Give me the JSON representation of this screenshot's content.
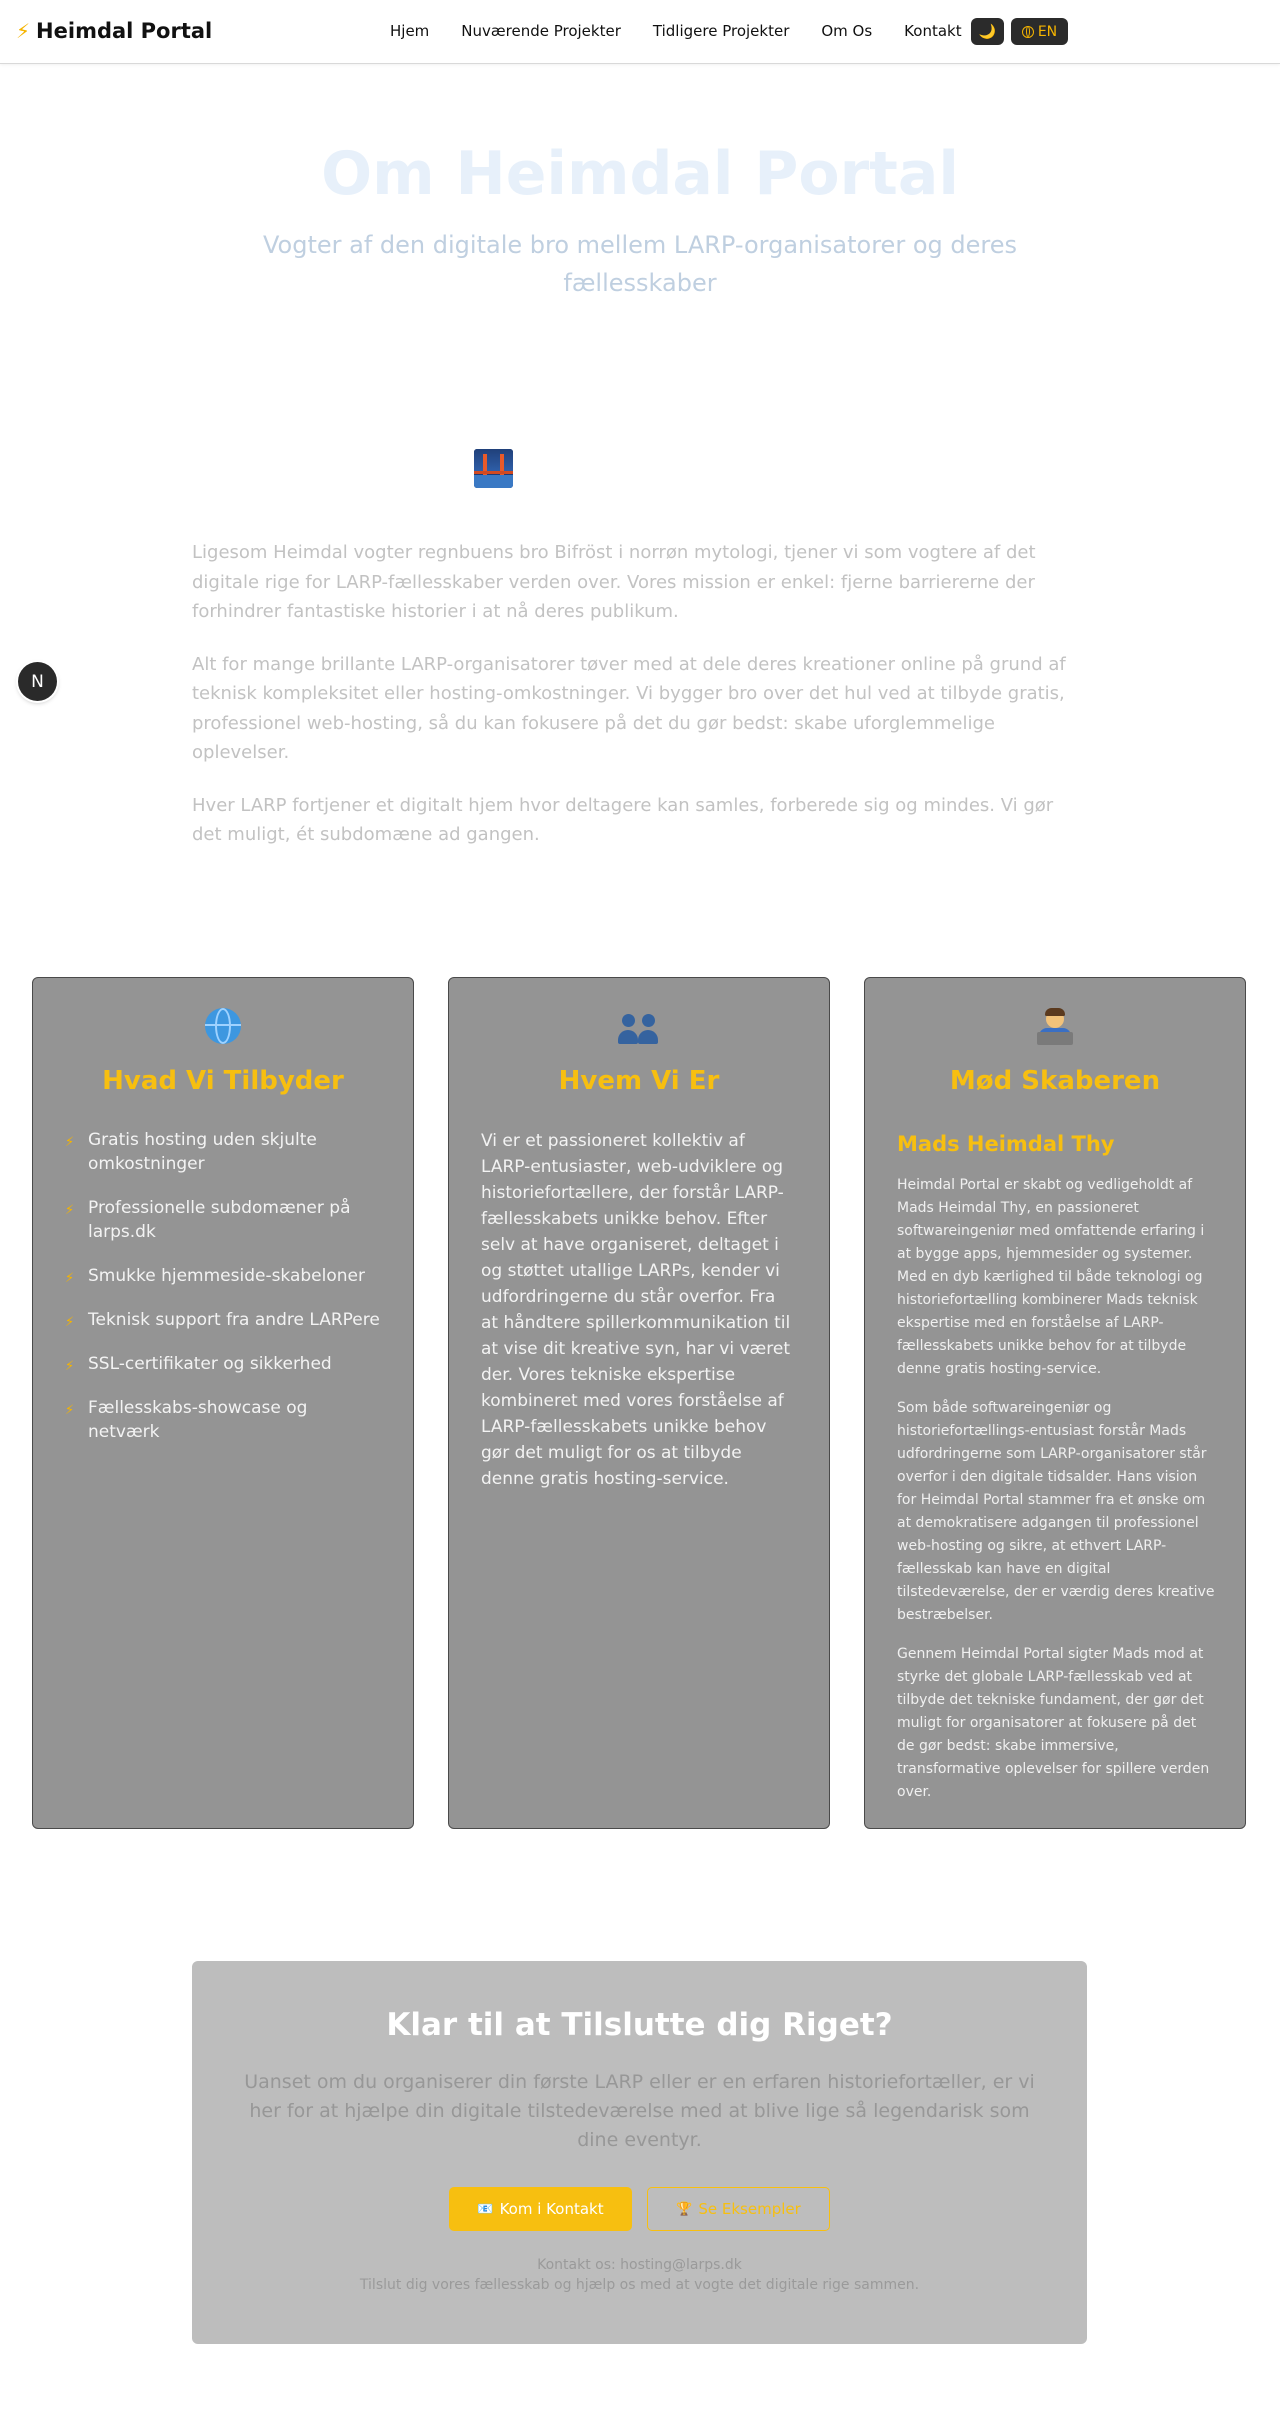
{
  "nav": {
    "brand_icon": "⚡",
    "brand_name": "Heimdal Portal",
    "links": [
      "Hjem",
      "Nuværende Projekter",
      "Tidligere Projekter",
      "Om Os",
      "Kontakt"
    ],
    "theme_icon": "moon-icon",
    "theme_glyph": "🌙",
    "lang_label": "EN"
  },
  "hero": {
    "title": "Om Heimdal Portal",
    "subtitle": "Vogter af den digitale bro mellem LARP-organisatorer og deres fællesskaber"
  },
  "story": {
    "icon": "bridge-icon",
    "paragraphs": [
      "Ligesom Heimdal vogter regnbuens bro Bifröst i norrøn mytologi, tjener vi som vogtere af det digitale rige for LARP-fællesskaber verden over. Vores mission er enkel: fjerne barriererne der forhindrer fantastiske historier i at nå deres publikum.",
      "Alt for mange brillante LARP-organisatorer tøver med at dele deres kreationer online på grund af teknisk kompleksitet eller hosting-omkostninger. Vi bygger bro over det hul ved at tilbyde gratis, professionel web-hosting, så du kan fokusere på det du gør bedst: skabe uforglemmelige oplevelser.",
      "Hver LARP fortjener et digitalt hjem hvor deltagere kan samles, forberede sig og mindes. Vi gør det muligt, ét subdomæne ad gangen."
    ]
  },
  "badge": {
    "letter": "N"
  },
  "cards": {
    "offer": {
      "icon": "globe-icon",
      "title": "Hvad Vi Tilbyder",
      "bullet_glyph": "⚡",
      "items": [
        "Gratis hosting uden skjulte omkostninger",
        "Professionelle subdomæner på larps.dk",
        "Smukke hjemmeside-skabeloner",
        "Teknisk support fra andre LARPere",
        "SSL-certifikater og sikkerhed",
        "Fællesskabs-showcase og netværk"
      ]
    },
    "who": {
      "icon": "people-icon",
      "title": "Hvem Vi Er",
      "text": "Vi er et passioneret kollektiv af LARP-entusiaster, web-udviklere og historiefortællere, der forstår LARP-fællesskabets unikke behov. Efter selv at have organiseret, deltaget i og støttet utallige LARPs, kender vi udfordringerne du står overfor. Fra at håndtere spillerkommunikation til at vise dit kreative syn, har vi været der. Vores tekniske ekspertise kombineret med vores forståelse af LARP-fællesskabets unikke behov gør det muligt for os at tilbyde denne gratis hosting-service."
    },
    "creator": {
      "icon": "technologist-icon",
      "title": "Mød Skaberen",
      "name": "Mads Heimdal Thy",
      "paragraphs": [
        "Heimdal Portal er skabt og vedligeholdt af Mads Heimdal Thy, en passioneret softwareingeniør med omfattende erfaring i at bygge apps, hjemmesider og systemer. Med en dyb kærlighed til både teknologi og historiefortælling kombinerer Mads teknisk ekspertise med en forståelse af LARP-fællesskabets unikke behov for at tilbyde denne gratis hosting-service.",
        "Som både softwareingeniør og historiefortællings-entusiast forstår Mads udfordringerne som LARP-organisatorer står overfor i den digitale tidsalder. Hans vision for Heimdal Portal stammer fra et ønske om at demokratisere adgangen til professionel web-hosting og sikre, at ethvert LARP-fællesskab kan have en digital tilstedeværelse, der er værdig deres kreative bestræbelser.",
        "Gennem Heimdal Portal sigter Mads mod at styrke det globale LARP-fællesskab ved at tilbyde det tekniske fundament, der gør det muligt for organisatorer at fokusere på det de gør bedst: skabe immersive, transformative oplevelser for spillere verden over."
      ]
    }
  },
  "cta": {
    "title": "Klar til at Tilslutte dig Riget?",
    "text": "Uanset om du organiserer din første LARP eller er en erfaren historiefortæller, er vi her for at hjælpe din digitale tilstedeværelse med at blive lige så legendarisk som dine eventyr.",
    "contact_button": {
      "icon": "envelope-icon",
      "glyph": "📧",
      "label": "Kom i Kontakt"
    },
    "examples_button": {
      "icon": "trophy-icon",
      "glyph": "🏆",
      "label": "Se Eksempler"
    },
    "contact_line": "Kontakt os: hosting@larps.dk",
    "join_line": "Tilslut dig vores fællesskab og hjælp os med at vogte det digitale rige sammen."
  },
  "colors": {
    "accent": "#f7bf10",
    "card_bg": "#949494",
    "cta_bg": "#bdbdbd",
    "nav_button_bg": "#2b2b2b"
  }
}
